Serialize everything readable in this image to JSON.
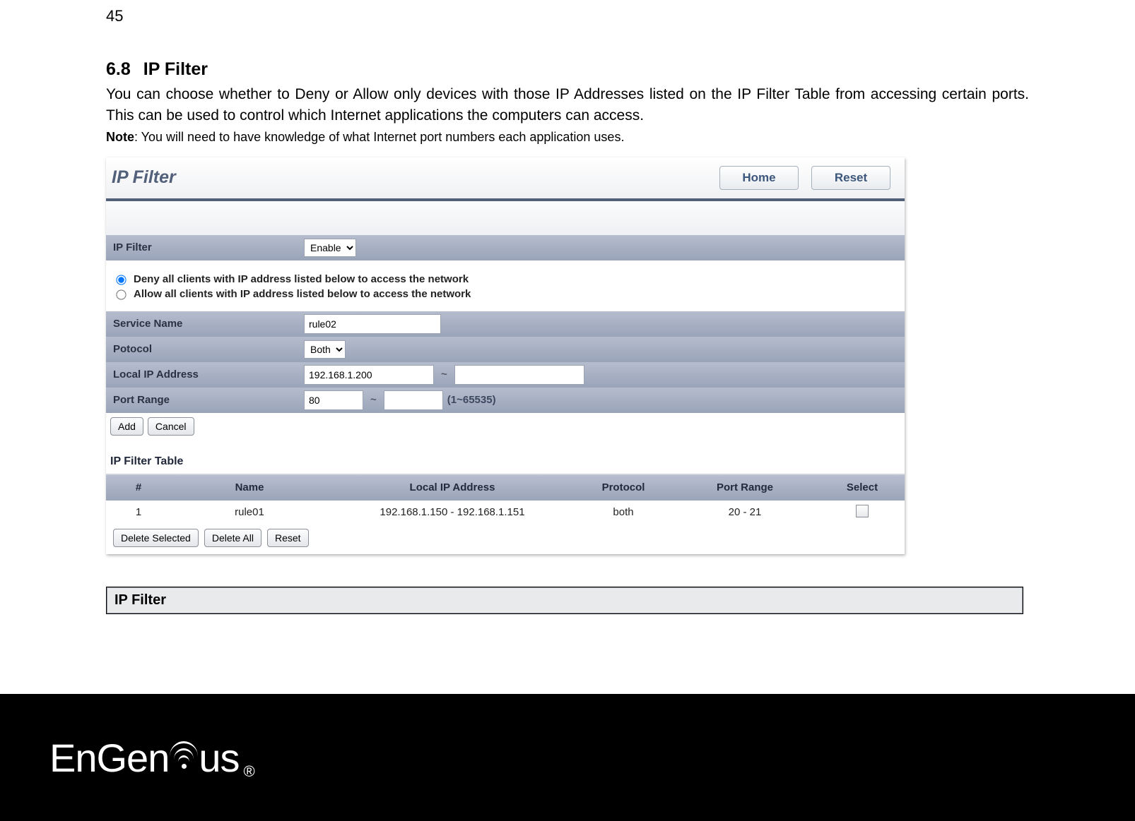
{
  "page_number": "45",
  "section": {
    "number": "6.8",
    "title": "IP Filter"
  },
  "paragraph": "You can choose whether to Deny or Allow only devices with those IP Addresses listed on the IP Filter Table from accessing certain ports. This can be used to control which Internet applications the computers can access.",
  "note_label": "Note",
  "note_text": ": You will need to have knowledge of what Internet port numbers each application uses.",
  "ui": {
    "title": "IP Filter",
    "home_btn": "Home",
    "reset_btn": "Reset",
    "enable_row": {
      "label": "IP Filter",
      "value": "Enable"
    },
    "radio_deny": "Deny all clients with IP address listed below to access the network",
    "radio_allow": "Allow all clients with IP address listed below to access the network",
    "form": {
      "service_label": "Service Name",
      "service_value": "rule02",
      "protocol_label": "Potocol",
      "protocol_value": "Both",
      "localip_label": "Local IP Address",
      "localip_from": "192.168.1.200",
      "localip_to": "",
      "port_label": "Port Range",
      "port_from": "80",
      "port_to": "",
      "port_hint": "(1~65535)",
      "add_btn": "Add",
      "cancel_btn": "Cancel"
    },
    "table_title": "IP Filter Table",
    "headers": {
      "idx": "#",
      "name": "Name",
      "ip": "Local IP Address",
      "proto": "Protocol",
      "range": "Port Range",
      "select": "Select"
    },
    "row": {
      "idx": "1",
      "name": "rule01",
      "ip": "192.168.1.150 - 192.168.1.151",
      "proto": "both",
      "range": "20 - 21"
    },
    "del_sel": "Delete Selected",
    "del_all": "Delete All",
    "reset2": "Reset"
  },
  "boxed_heading": "IP Filter",
  "brand": {
    "part1": "En",
    "part2": "Gen",
    "part3": "us"
  }
}
